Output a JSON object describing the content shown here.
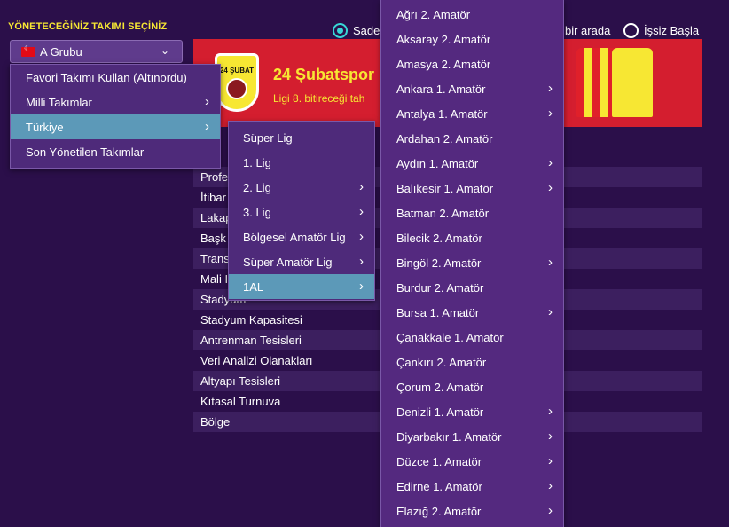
{
  "header": {
    "title": "YÖNETECEĞİNİZ TAKIMI SEÇİNİZ"
  },
  "group_select": {
    "value": "A Grubu",
    "flag_icon": "turkey-flag-icon"
  },
  "radio_options": [
    {
      "label": "Sade",
      "selected": true
    },
    {
      "label": "bir arada",
      "selected": false
    },
    {
      "label": "İşsiz Başla",
      "selected": false
    }
  ],
  "banner": {
    "team_name": "24 Şubatspor",
    "subtitle": "Ligi 8. bitireceği tah",
    "crest_text": "24 ŞUBAT",
    "colors": {
      "banner": "#d41e2f",
      "accent": "#f7e733"
    }
  },
  "attributes": [
    "Profe",
    "İtibar",
    "Lakap",
    "Başk",
    "Trans",
    "Mali I",
    "Stadyum",
    "Stadyum Kapasitesi",
    "Antrenman Tesisleri",
    "Veri Analizi Olanakları",
    "Altyapı Tesisleri",
    "Kıtasal Turnuva",
    "Bölge"
  ],
  "menu1": {
    "items": [
      {
        "label": "Favori Takımı Kullan (Altınordu)",
        "submenu": false,
        "selected": false
      },
      {
        "label": "Milli Takımlar",
        "submenu": true,
        "selected": false
      },
      {
        "label": "Türkiye",
        "submenu": true,
        "selected": true
      },
      {
        "label": "Son Yönetilen Takımlar",
        "submenu": false,
        "selected": false
      }
    ]
  },
  "menu2": {
    "items": [
      {
        "label": "Süper Lig",
        "submenu": false,
        "selected": false
      },
      {
        "label": "1. Lig",
        "submenu": false,
        "selected": false
      },
      {
        "label": "2. Lig",
        "submenu": true,
        "selected": false
      },
      {
        "label": "3. Lig",
        "submenu": true,
        "selected": false
      },
      {
        "label": "Bölgesel Amatör Lig",
        "submenu": true,
        "selected": false
      },
      {
        "label": "Süper Amatör Lig",
        "submenu": true,
        "selected": false
      },
      {
        "label": "1AL",
        "submenu": true,
        "selected": true
      }
    ]
  },
  "menu3": {
    "items": [
      {
        "label": "Ağrı 2. Amatör",
        "submenu": false
      },
      {
        "label": "Aksaray 2. Amatör",
        "submenu": false
      },
      {
        "label": "Amasya 2. Amatör",
        "submenu": false
      },
      {
        "label": "Ankara 1. Amatör",
        "submenu": true
      },
      {
        "label": "Antalya 1. Amatör",
        "submenu": true
      },
      {
        "label": "Ardahan 2. Amatör",
        "submenu": false
      },
      {
        "label": "Aydın 1. Amatör",
        "submenu": true
      },
      {
        "label": "Balıkesir 1. Amatör",
        "submenu": true
      },
      {
        "label": "Batman 2. Amatör",
        "submenu": false
      },
      {
        "label": "Bilecik 2. Amatör",
        "submenu": false
      },
      {
        "label": "Bingöl 2. Amatör",
        "submenu": true
      },
      {
        "label": "Burdur 2. Amatör",
        "submenu": false
      },
      {
        "label": "Bursa 1. Amatör",
        "submenu": true
      },
      {
        "label": "Çanakkale 1. Amatör",
        "submenu": false
      },
      {
        "label": "Çankırı 2. Amatör",
        "submenu": false
      },
      {
        "label": "Çorum 2. Amatör",
        "submenu": false
      },
      {
        "label": "Denizli 1. Amatör",
        "submenu": true
      },
      {
        "label": "Diyarbakır 1. Amatör",
        "submenu": true
      },
      {
        "label": "Düzce 1. Amatör",
        "submenu": true
      },
      {
        "label": "Edirne 1. Amatör",
        "submenu": true
      },
      {
        "label": "Elazığ 2. Amatör",
        "submenu": true
      }
    ]
  }
}
